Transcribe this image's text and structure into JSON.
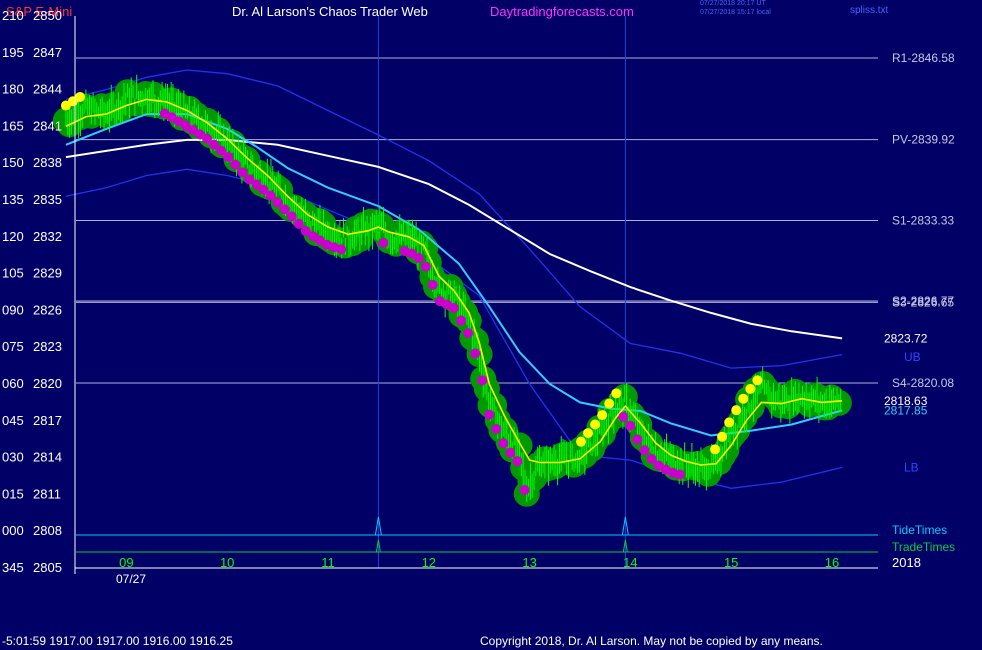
{
  "header": {
    "symbol": "S&P E-Mini",
    "site": "Dr. Al Larson's Chaos Trader Web",
    "url": "Daytradingforecasts.com",
    "utc_stamp": "07/27/2018 20:17 UT",
    "local_stamp": "07/27/2018 15:17 local",
    "file": "spliss.txt"
  },
  "footer": {
    "readout": "-5:01:59  1917.00 1917.00 1916.00 1916.25",
    "copyright": "Copyright 2018, Dr. Al Larson. May not be copied by any means."
  },
  "colors": {
    "background": "#000066",
    "price_bars": "#00ff00",
    "green_glow": "#009900",
    "yellow_line": "#ffff00",
    "magenta_dots": "#cc00cc",
    "cyan_line": "#33ccff",
    "white_line": "#ffffff",
    "bands": "#2233ee",
    "levels": "#b0b0d8",
    "tide": "#00ccff",
    "trade": "#00cc44"
  },
  "chart_data": {
    "type": "line",
    "ylim": [
      2805,
      2850
    ],
    "x_range": [
      8.5,
      16.2
    ],
    "y_ticks": [
      {
        "left": "210",
        "price": "2850"
      },
      {
        "left": "195",
        "price": "2847"
      },
      {
        "left": "180",
        "price": "2844"
      },
      {
        "left": "165",
        "price": "2841"
      },
      {
        "left": "150",
        "price": "2838"
      },
      {
        "left": "135",
        "price": "2835"
      },
      {
        "left": "120",
        "price": "2832"
      },
      {
        "left": "105",
        "price": "2829"
      },
      {
        "left": "090",
        "price": "2826"
      },
      {
        "left": "075",
        "price": "2823"
      },
      {
        "left": "060",
        "price": "2820"
      },
      {
        "left": "045",
        "price": "2817"
      },
      {
        "left": "030",
        "price": "2814"
      },
      {
        "left": "015",
        "price": "2811"
      },
      {
        "left": "000",
        "price": "2808"
      },
      {
        "left": "345",
        "price": "2805"
      }
    ],
    "x_ticks": [
      {
        "x": 9,
        "label": "09"
      },
      {
        "x": 10,
        "label": "10"
      },
      {
        "x": 11,
        "label": "11"
      },
      {
        "x": 12,
        "label": "12"
      },
      {
        "x": 13,
        "label": "13"
      },
      {
        "x": 14,
        "label": "14"
      },
      {
        "x": 15,
        "label": "15"
      },
      {
        "x": 16,
        "label": "16"
      }
    ],
    "date_label": "07/27",
    "year_label": "2018",
    "levels": [
      {
        "name": "R1-2846.58",
        "value": 2846.58
      },
      {
        "name": "PV-2839.92",
        "value": 2839.92
      },
      {
        "name": "S1-2833.33",
        "value": 2833.33
      },
      {
        "name": "S2-2826.77",
        "value": 2826.77
      },
      {
        "name": "S3-2826.65",
        "value": 2826.65
      },
      {
        "name": "S4-2820.08",
        "value": 2820.08
      }
    ],
    "vertical_markers": [
      11.5,
      13.95
    ],
    "series": [
      {
        "name": "price",
        "role": "bars",
        "x": [
          8.4,
          8.6,
          8.8,
          9.0,
          9.2,
          9.4,
          9.6,
          9.8,
          10.0,
          10.2,
          10.4,
          10.6,
          10.8,
          11.0,
          11.2,
          11.4,
          11.5,
          11.6,
          11.8,
          11.95,
          12.1,
          12.25,
          12.4,
          12.5,
          12.6,
          12.75,
          12.9,
          12.97,
          13.1,
          13.3,
          13.5,
          13.7,
          13.85,
          13.95,
          14.1,
          14.25,
          14.4,
          14.55,
          14.7,
          14.85,
          15.0,
          15.15,
          15.3,
          15.5,
          15.7,
          15.9,
          16.1
        ],
        "y": [
          2841.5,
          2842.5,
          2842.0,
          2843.3,
          2843.5,
          2843.0,
          2842.0,
          2841.0,
          2839.6,
          2837.8,
          2836.6,
          2835.0,
          2833.3,
          2832.3,
          2831.8,
          2832.6,
          2833.0,
          2832.0,
          2831.8,
          2831.0,
          2827.8,
          2827.2,
          2825.0,
          2822.5,
          2818.5,
          2816.0,
          2814.5,
          2811.5,
          2813.5,
          2813.8,
          2814.0,
          2816.0,
          2818.0,
          2818.4,
          2816.0,
          2814.5,
          2813.8,
          2813.5,
          2813.0,
          2813.5,
          2816.0,
          2818.0,
          2819.5,
          2818.5,
          2819.0,
          2818.5,
          2818.63
        ]
      },
      {
        "name": "yellow",
        "role": "line",
        "x": [
          8.4,
          8.6,
          8.8,
          9.0,
          9.2,
          9.4,
          9.6,
          9.8,
          10.0,
          10.2,
          10.4,
          10.6,
          10.8,
          11.0,
          11.2,
          11.4,
          11.5,
          11.6,
          11.8,
          11.95,
          12.1,
          12.25,
          12.4,
          12.5,
          12.6,
          12.75,
          12.9,
          13.0,
          13.1,
          13.3,
          13.5,
          13.7,
          13.85,
          13.95,
          14.1,
          14.25,
          14.4,
          14.55,
          14.7,
          14.85,
          15.0,
          15.15,
          15.3,
          15.5,
          15.7,
          15.9,
          16.1
        ],
        "y": [
          2841.0,
          2841.8,
          2842.0,
          2842.7,
          2843.2,
          2843.0,
          2842.3,
          2841.3,
          2840.0,
          2838.4,
          2837.0,
          2835.3,
          2833.8,
          2832.8,
          2832.2,
          2832.5,
          2832.8,
          2832.4,
          2832.0,
          2831.3,
          2828.8,
          2827.6,
          2825.8,
          2823.4,
          2820.0,
          2817.4,
          2815.2,
          2813.8,
          2813.6,
          2813.6,
          2813.9,
          2815.3,
          2817.2,
          2818.2,
          2816.8,
          2815.2,
          2814.2,
          2813.7,
          2813.4,
          2813.5,
          2815.0,
          2817.0,
          2818.5,
          2818.4,
          2818.8,
          2818.5,
          2818.63
        ]
      },
      {
        "name": "cyan",
        "role": "line",
        "x": [
          8.4,
          8.8,
          9.2,
          9.6,
          10.0,
          10.3,
          10.6,
          11.0,
          11.5,
          11.9,
          12.3,
          12.6,
          12.9,
          13.2,
          13.5,
          13.8,
          14.1,
          14.4,
          14.8,
          15.2,
          15.6,
          16.1
        ],
        "y": [
          2839.5,
          2840.8,
          2842.0,
          2842.0,
          2840.8,
          2839.3,
          2837.6,
          2836.0,
          2834.5,
          2832.6,
          2829.8,
          2826.3,
          2822.6,
          2820.0,
          2818.5,
          2818.0,
          2817.8,
          2816.8,
          2815.8,
          2816.2,
          2816.7,
          2817.85
        ]
      },
      {
        "name": "white",
        "role": "line",
        "x": [
          8.4,
          8.8,
          9.2,
          9.6,
          10.0,
          10.5,
          11.0,
          11.5,
          12.0,
          12.4,
          12.8,
          13.2,
          13.6,
          14.0,
          14.4,
          14.8,
          15.2,
          15.6,
          16.1
        ],
        "y": [
          2838.5,
          2839.0,
          2839.5,
          2839.9,
          2839.9,
          2839.5,
          2838.6,
          2837.7,
          2836.3,
          2834.6,
          2832.6,
          2830.6,
          2829.2,
          2827.9,
          2826.8,
          2825.8,
          2824.9,
          2824.3,
          2823.72
        ]
      },
      {
        "name": "UB",
        "role": "band",
        "x": [
          8.4,
          8.8,
          9.2,
          9.6,
          10.0,
          10.5,
          11.0,
          11.5,
          12.0,
          12.5,
          13.0,
          13.5,
          14.0,
          14.5,
          15.0,
          15.5,
          16.1
        ],
        "y": [
          2843.2,
          2844.0,
          2845.0,
          2845.6,
          2845.3,
          2844.3,
          2842.3,
          2840.3,
          2838.2,
          2835.5,
          2831.0,
          2826.3,
          2823.3,
          2822.5,
          2821.3,
          2821.5,
          2822.4
        ]
      },
      {
        "name": "LB",
        "role": "band",
        "x": [
          8.4,
          8.8,
          9.2,
          9.6,
          10.0,
          10.5,
          11.0,
          11.5,
          12.0,
          12.5,
          13.0,
          13.5,
          14.0,
          14.5,
          15.0,
          15.5,
          16.1
        ],
        "y": [
          2835.3,
          2836.0,
          2837.0,
          2837.5,
          2837.0,
          2836.0,
          2834.2,
          2832.5,
          2830.3,
          2827.2,
          2820.0,
          2814.2,
          2813.8,
          2812.5,
          2811.5,
          2812.0,
          2813.2
        ]
      }
    ],
    "right_labels": [
      {
        "text": "2823.72",
        "value": 2823.72,
        "color": "#ffffff"
      },
      {
        "text": "UB",
        "value": 2822.2,
        "color": "#3344ff"
      },
      {
        "text": "2818.63",
        "value": 2818.63,
        "color": "#ffffff"
      },
      {
        "text": "2817.85",
        "value": 2817.85,
        "color": "#33ccff"
      },
      {
        "text": "LB",
        "value": 2813.2,
        "color": "#3344ff"
      }
    ],
    "bottom_lines": [
      {
        "name": "TideTimes",
        "color": "#00ccff"
      },
      {
        "name": "TradeTimes",
        "color": "#00cc44"
      }
    ]
  }
}
